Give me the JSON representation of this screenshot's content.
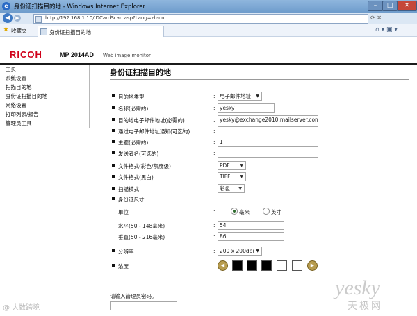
{
  "window": {
    "title": "身份证扫描目的地 - Windows Internet Explorer",
    "ie_glyph": "e",
    "minimize": "–",
    "maximize": "□",
    "close": "✕"
  },
  "address": {
    "url": "http://192.168.1.10/IDCardScan.asp?Lang=zh-cn",
    "icons": "⟳ ✕"
  },
  "favorites": {
    "label": "收藏夹",
    "tab_label": "身份证扫描目的地",
    "cmd_icons": "⌂ ▾ ▣ ▾"
  },
  "brand": {
    "logo": "RICOH",
    "model": "MP 2014AD",
    "subtitle": "Web image monitor"
  },
  "sidebar": {
    "items": [
      {
        "label": "主页"
      },
      {
        "label": "系统设置"
      },
      {
        "label": "扫描目的地"
      },
      {
        "label": "身份证扫描目的地"
      },
      {
        "label": "网络设置"
      },
      {
        "label": "打印列表/报告"
      },
      {
        "label": "管理员工具"
      }
    ]
  },
  "main": {
    "title": "身份证扫描目的地",
    "fields": {
      "dest_type": {
        "label": "目的地类型",
        "value": "电子邮件地址"
      },
      "name": {
        "label": "名称(必需的)",
        "value": "yesky"
      },
      "email": {
        "label": "目的地电子邮件地址(必需的)",
        "value": "yesky@exchange2010.mailserver.com"
      },
      "notify": {
        "label": "通过电子邮件地址通知(可选的)",
        "value": ""
      },
      "subject": {
        "label": "主题(必需的)",
        "value": "1"
      },
      "sender": {
        "label": "发送者名(可选的)",
        "value": ""
      },
      "format_color": {
        "label": "文件格式(彩色/灰度级)",
        "value": "PDF"
      },
      "format_bw": {
        "label": "文件格式(黑白)",
        "value": "TIFF"
      },
      "scan_mode": {
        "label": "扫描模式",
        "value": "彩色"
      },
      "id_size": {
        "label": "身份证尺寸"
      },
      "unit": {
        "label": "单位",
        "option_mm": "毫米",
        "option_inch": "英寸",
        "selected": "毫米"
      },
      "horizontal": {
        "label": "水平(50 - 148毫米)",
        "value": "54"
      },
      "vertical": {
        "label": "垂直(50 - 216毫米)",
        "value": "86"
      },
      "resolution": {
        "label": "分辨率",
        "value": "200 x 200dpi"
      },
      "density": {
        "label": "浓度",
        "level": 3,
        "steps": 5
      }
    },
    "colon": ":",
    "arrow": "▼",
    "prev": "◀",
    "next": "▶"
  },
  "admin": {
    "label": "请输入管理员密码。"
  },
  "watermarks": {
    "left": "@ 大数跨境",
    "right": "yesky",
    "right_cn": "天极网"
  },
  "colors": {
    "brand_red": "#d0021b",
    "density_button": "#b79c4e"
  }
}
